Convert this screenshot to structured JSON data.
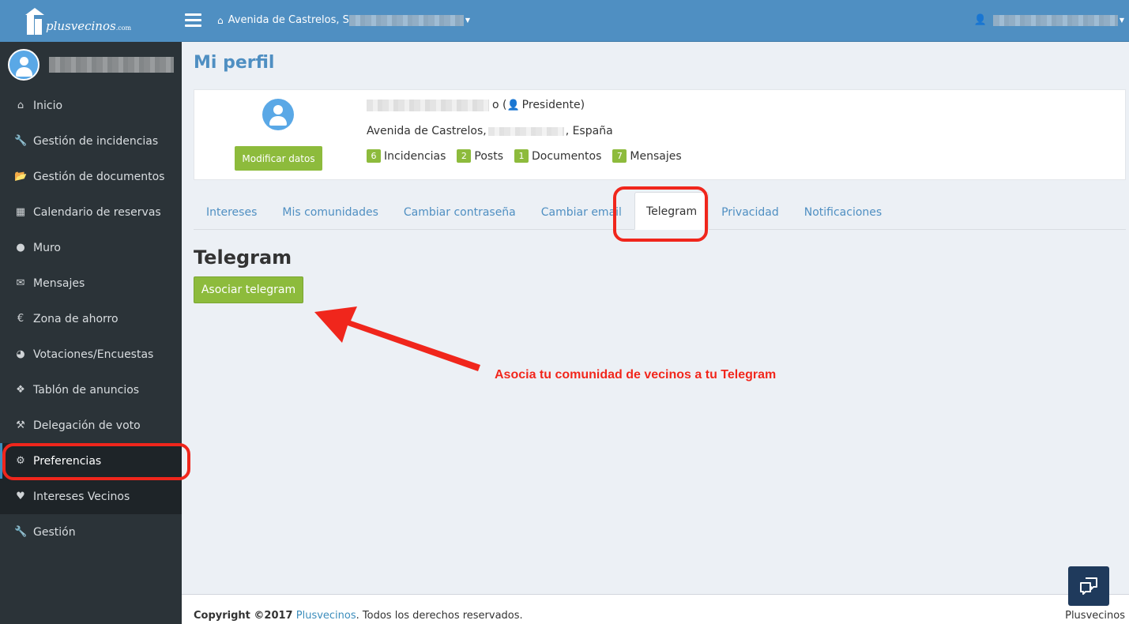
{
  "brand": {
    "name": "plusvecinos",
    "suffix": ".com"
  },
  "header": {
    "address": "Avenida de Castrelos, S",
    "menu_icon": "hamburger-icon",
    "user_icon": "user-icon"
  },
  "sidebar": {
    "items": [
      {
        "label": "Inicio",
        "icon": "home-icon"
      },
      {
        "label": "Gestión de incidencias",
        "icon": "wrench-icon"
      },
      {
        "label": "Gestión de documentos",
        "icon": "folder-icon"
      },
      {
        "label": "Calendario de reservas",
        "icon": "calendar-icon"
      },
      {
        "label": "Muro",
        "icon": "comments-icon"
      },
      {
        "label": "Mensajes",
        "icon": "envelope-icon"
      },
      {
        "label": "Zona de ahorro",
        "icon": "euro-icon"
      },
      {
        "label": "Votaciones/Encuestas",
        "icon": "pie-chart-icon"
      },
      {
        "label": "Tablón de anuncios",
        "icon": "tags-icon"
      },
      {
        "label": "Delegación de voto",
        "icon": "gavel-icon"
      },
      {
        "label": "Preferencias",
        "icon": "cogs-icon"
      },
      {
        "label": "Intereses Vecinos",
        "icon": "heart-icon"
      },
      {
        "label": "Gestión",
        "icon": "wrench-icon"
      }
    ]
  },
  "page": {
    "title": "Mi perfil"
  },
  "profile": {
    "role_prefix": "o (",
    "role": "Presidente)",
    "address_prefix": "Avenida de Castrelos,",
    "address_suffix": ", España",
    "edit_button": "Modificar datos",
    "stats": [
      {
        "count": "6",
        "label": "Incidencias"
      },
      {
        "count": "2",
        "label": "Posts"
      },
      {
        "count": "1",
        "label": "Documentos"
      },
      {
        "count": "7",
        "label": "Mensajes"
      }
    ]
  },
  "tabs": [
    {
      "label": "Intereses"
    },
    {
      "label": "Mis comunidades"
    },
    {
      "label": "Cambiar contraseña"
    },
    {
      "label": "Cambiar email"
    },
    {
      "label": "Telegram"
    },
    {
      "label": "Privacidad"
    },
    {
      "label": "Notificaciones"
    }
  ],
  "telegram": {
    "title": "Telegram",
    "button": "Asociar telegram"
  },
  "annotation": {
    "text": "Asocia tu comunidad de vecinos a tu Telegram",
    "color": "#f0261c"
  },
  "footer": {
    "copyright_prefix": "Copyright ©2017",
    "link": "Plusvecinos",
    "suffix": ". Todos los derechos reservados.",
    "right": "Plusvecinos"
  },
  "colors": {
    "primary": "#4f8fc2",
    "sidebar": "#2b3338",
    "accent_green": "#8dbb3c"
  }
}
